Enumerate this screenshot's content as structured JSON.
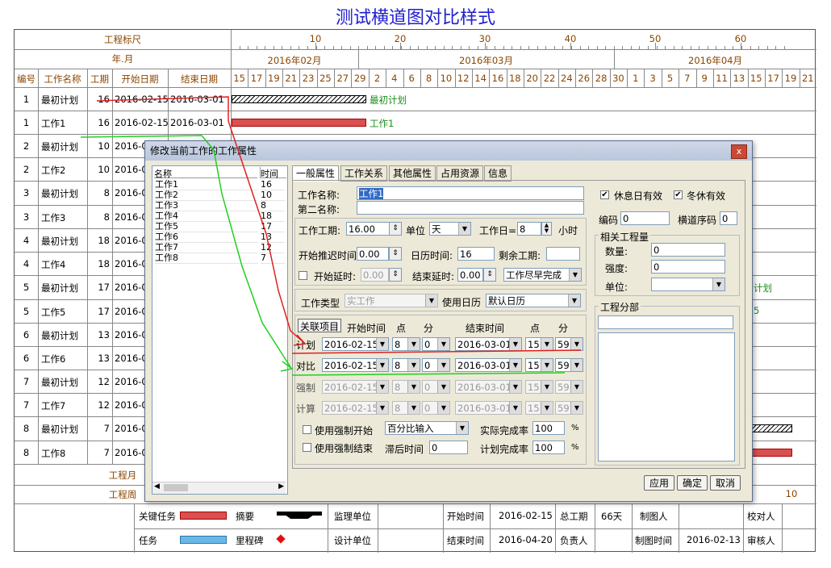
{
  "title": "测试横道图对比样式",
  "header": {
    "scale_label": "工程标尺",
    "month_label": "年.月",
    "scale_ticks": [
      "10",
      "20",
      "30",
      "40",
      "50",
      "60"
    ],
    "months": [
      "2016年02月",
      "2016年03月",
      "2016年04月"
    ],
    "columns": [
      "编号",
      "工作名称",
      "工期",
      "开始日期",
      "结束日期"
    ],
    "days": [
      "15",
      "17",
      "19",
      "21",
      "23",
      "25",
      "27",
      "29",
      "2",
      "4",
      "6",
      "8",
      "10",
      "12",
      "14",
      "16",
      "18",
      "20",
      "22",
      "24",
      "26",
      "28",
      "30",
      "1",
      "3",
      "5",
      "7",
      "9",
      "11",
      "13",
      "15",
      "17",
      "19",
      "21"
    ]
  },
  "rows": [
    {
      "id": "1",
      "name": "最初计划",
      "dur": "16",
      "start": "2016-02-15",
      "end": "2016-03-01",
      "bar_label": "最初计划"
    },
    {
      "id": "1",
      "name": "工作1",
      "dur": "16",
      "start": "2016-02-15",
      "end": "2016-03-01",
      "bar_label": "工作1"
    },
    {
      "id": "2",
      "name": "最初计划",
      "dur": "10",
      "start": "2016-0"
    },
    {
      "id": "2",
      "name": "工作2",
      "dur": "10",
      "start": "2016-0"
    },
    {
      "id": "3",
      "name": "最初计划",
      "dur": "8",
      "start": "2016-0"
    },
    {
      "id": "3",
      "name": "工作3",
      "dur": "8",
      "start": "2016-0"
    },
    {
      "id": "4",
      "name": "最初计划",
      "dur": "18",
      "start": "2016-0"
    },
    {
      "id": "4",
      "name": "工作4",
      "dur": "18",
      "start": "2016-0"
    },
    {
      "id": "5",
      "name": "最初计划",
      "dur": "17",
      "start": "2016-0",
      "bar_label": "计划"
    },
    {
      "id": "5",
      "name": "工作5",
      "dur": "17",
      "start": "2016-0",
      "bar_label": "5"
    },
    {
      "id": "6",
      "name": "最初计划",
      "dur": "13",
      "start": "2016-0"
    },
    {
      "id": "6",
      "name": "工作6",
      "dur": "13",
      "start": "2016-0"
    },
    {
      "id": "7",
      "name": "最初计划",
      "dur": "12",
      "start": "2016-0"
    },
    {
      "id": "7",
      "name": "工作7",
      "dur": "12",
      "start": "2016-0"
    },
    {
      "id": "8",
      "name": "最初计划",
      "dur": "7",
      "start": "2016-0"
    },
    {
      "id": "8",
      "name": "工作8",
      "dur": "7",
      "start": "2016-0"
    }
  ],
  "bottom": {
    "month_label": "工程月",
    "week_label": "工程周",
    "week_end_value": "10"
  },
  "legend": {
    "critical": "关键任务",
    "summary": "摘要",
    "task": "任务",
    "milestone": "里程碑",
    "supervisor": "监理单位",
    "designer": "设计单位",
    "start_time_label": "开始时间",
    "start_time": "2016-02-15",
    "end_time_label": "结束时间",
    "end_time": "2016-04-20",
    "total_label": "总工期",
    "total": "66天",
    "owner_label": "负责人",
    "maker_label": "制图人",
    "make_time_label": "制图时间",
    "make_time": "2016-02-13",
    "checker_label": "校对人",
    "reviewer_label": "审核人"
  },
  "dialog": {
    "title": "修改当前工作的工作属性",
    "close": "x",
    "list_headers": [
      "名称",
      "时间"
    ],
    "list": [
      [
        "工作1",
        "16"
      ],
      [
        "工作2",
        "10"
      ],
      [
        "工作3",
        "8"
      ],
      [
        "工作4",
        "18"
      ],
      [
        "工作5",
        "17"
      ],
      [
        "工作6",
        "13"
      ],
      [
        "工作7",
        "12"
      ],
      [
        "工作8",
        "7"
      ]
    ],
    "tabs": [
      "一般属性",
      "工作关系",
      "其他属性",
      "占用资源",
      "信息"
    ],
    "name_label": "工作名称:",
    "name_value": "工作1",
    "second_name_label": "第二名称:",
    "duration_label": "工作工期:",
    "duration_value": "16.00",
    "unit_label": "单位",
    "unit_value": "天",
    "workday_label": "工作日=",
    "workday_value": "8",
    "hour_label": "小时",
    "push_label": "开始推迟时间",
    "push_value": "0.00",
    "calendar_time_label": "日历时间:",
    "calendar_time_value": "16",
    "remaining_label": "剩余工期:",
    "start_delay_label": "开始延时:",
    "start_delay_value": "0.00",
    "end_delay_label": "结束延时:",
    "end_delay_value": "0.00",
    "finish_mode": "工作尽早完成",
    "worktype_label": "工作类型",
    "worktype_value": "实工作",
    "use_cal_label": "使用日历",
    "use_cal_value": "默认日历",
    "grid_headers": [
      "关联项目",
      "开始时间",
      "点",
      "分",
      "结束时间",
      "点",
      "分"
    ],
    "grid_rows": [
      {
        "label": "计划",
        "start": "2016-02-15",
        "sh": "8",
        "sm": "0",
        "end": "2016-03-01",
        "eh": "15",
        "em": "59",
        "enabled": true
      },
      {
        "label": "对比",
        "start": "2016-02-15",
        "sh": "8",
        "sm": "0",
        "end": "2016-03-01",
        "eh": "15",
        "em": "59",
        "enabled": true
      },
      {
        "label": "强制",
        "start": "2016-02-15",
        "sh": "8",
        "sm": "0",
        "end": "2016-03-01",
        "eh": "15",
        "em": "59",
        "enabled": false
      },
      {
        "label": "计算",
        "start": "2016-02-15",
        "sh": "8",
        "sm": "0",
        "end": "2016-03-01",
        "eh": "15",
        "em": "59",
        "enabled": false
      }
    ],
    "force_start_label": "使用强制开始",
    "force_end_label": "使用强制结束",
    "percent_mode": "百分比输入",
    "actual_rate_label": "实际完成率",
    "actual_rate": "100",
    "pct": "%",
    "lag_label": "滞后时间",
    "lag_value": "0",
    "plan_rate_label": "计划完成率",
    "plan_rate": "100",
    "rest_valid_label": "休息日有效",
    "winter_valid_label": "冬休有效",
    "code_label": "编码",
    "code_value": "0",
    "lane_label": "横道序码",
    "lane_value": "0",
    "qty_group": "相关工程量",
    "qty_label": "数量:",
    "qty_value": "0",
    "strength_label": "强度:",
    "strength_value": "0",
    "unit2_label": "单位:",
    "section_label": "工程分部",
    "apply": "应用",
    "ok": "确定",
    "cancel": "取消"
  }
}
